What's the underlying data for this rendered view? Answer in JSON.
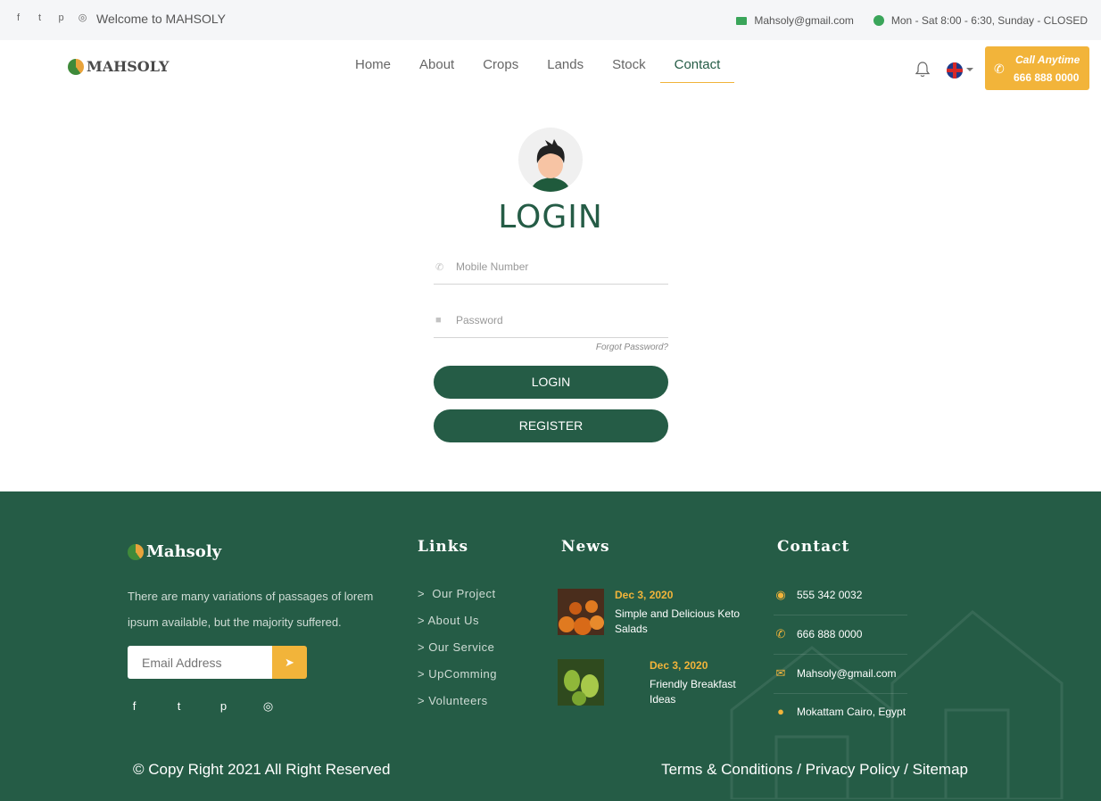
{
  "topbar": {
    "welcome": "Welcome to MAHSOLY",
    "email": "Mahsoly@gmail.com",
    "hours": "Mon - Sat 8:00 - 6:30, Sunday - CLOSED",
    "social_icons": [
      "facebook-icon",
      "twitter-icon",
      "pinterest-icon",
      "instagram-icon"
    ]
  },
  "nav": {
    "logo": "MAHSOLY",
    "items": [
      "Home",
      "About",
      "Crops",
      "Lands",
      "Stock",
      "Contact"
    ],
    "active": "Contact",
    "call_label": "Call Anytime",
    "call_number": "666 888 0000"
  },
  "login": {
    "title": "LOGIN",
    "mobile_placeholder": "Mobile Number",
    "password_placeholder": "Password",
    "forgot": "Forgot Password?",
    "login_button": "LOGIN",
    "register_button": "REGISTER"
  },
  "footer": {
    "logo": "Mahsoly",
    "about": "There are many variations of passages of lorem ipsum available, but the majority suffered.",
    "email_placeholder": "Email Address",
    "links_heading": "Links",
    "links": [
      "Our Project",
      "About Us",
      "Our Service",
      "UpComming",
      "Volunteers"
    ],
    "news_heading": "News",
    "news": [
      {
        "date": "Dec 3, 2020",
        "title": "Simple and Delicious Keto Salads"
      },
      {
        "date": "Dec 3, 2020",
        "title": "Friendly Breakfast Ideas"
      }
    ],
    "contact_heading": "Contact",
    "contact": {
      "whatsapp": "555 342 0032",
      "phone": "666 888 0000",
      "email": "Mahsoly@gmail.com",
      "address": "Mokattam Cairo, Egypt"
    },
    "copyright": "© Copy Right 2021 All Right Reserved",
    "terms": "Terms & Conditions / Privacy Policy / Sitemap"
  },
  "colors": {
    "primary_green": "#255c46",
    "accent_yellow": "#f2b43a",
    "topbar_bg": "#f5f6f8"
  }
}
